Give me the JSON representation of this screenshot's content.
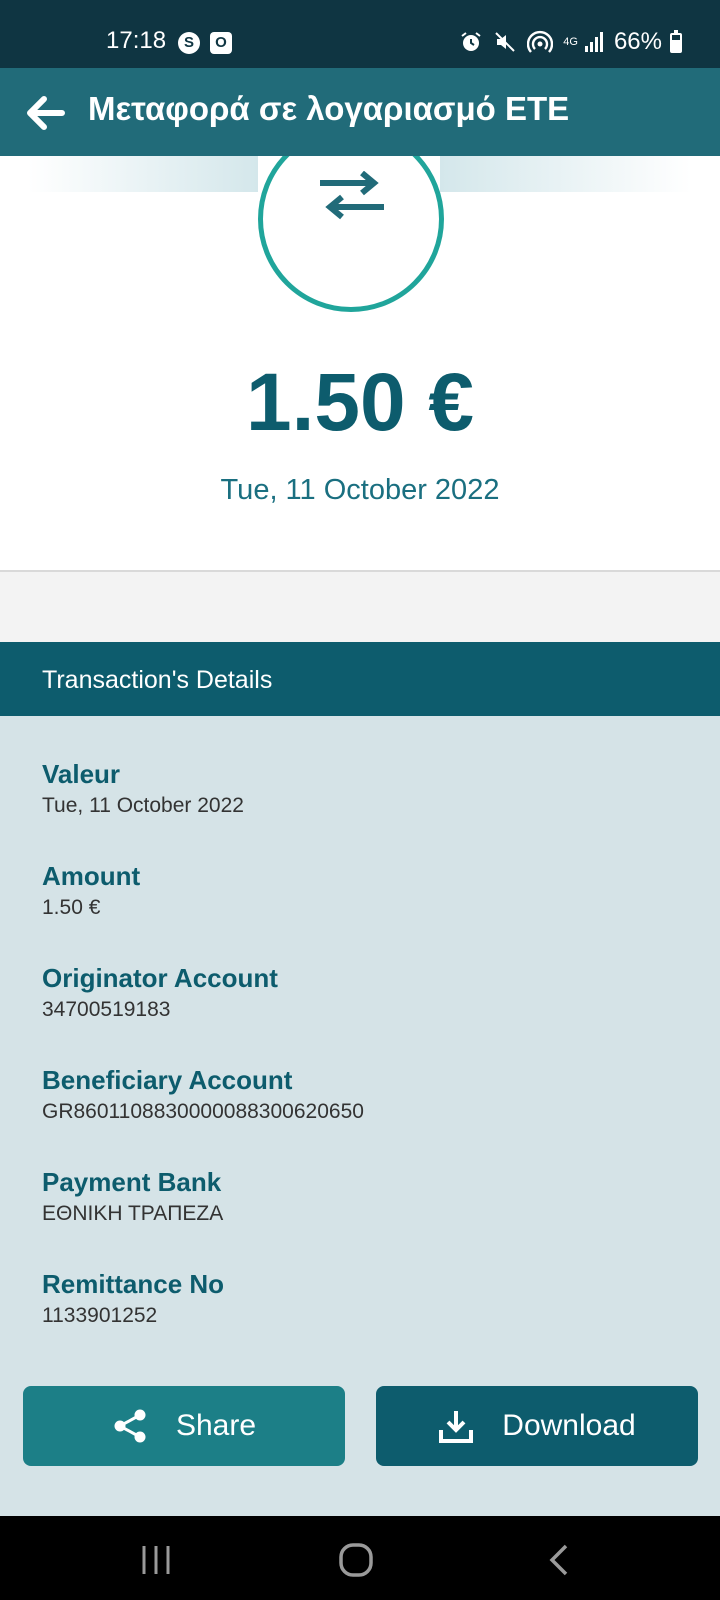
{
  "status_bar": {
    "time": "17:18",
    "app_icons": [
      "S",
      "O"
    ],
    "network": "4G",
    "battery_text": "66%",
    "battery_level": 0.66
  },
  "app_bar": {
    "title": "Μεταφορά σε λογαριασμό ETE"
  },
  "hero": {
    "amount": "1.50 €",
    "date": "Tue, 11 October 2022"
  },
  "details": {
    "header": "Transaction's Details",
    "items": [
      {
        "label": "Valeur",
        "value": "Tue, 11 October 2022"
      },
      {
        "label": "Amount",
        "value": "1.50 €"
      },
      {
        "label": "Originator Account",
        "value": "34700519183"
      },
      {
        "label": "Beneficiary Account",
        "value": "GR8601108830000088300620650"
      },
      {
        "label": "Payment Bank",
        "value": "ΕΘΝΙΚΗ ΤΡΑΠΕΖΑ"
      },
      {
        "label": "Remittance No",
        "value": "1133901252"
      }
    ]
  },
  "actions": {
    "share_label": "Share",
    "download_label": "Download"
  },
  "colors": {
    "primary_dark": "#0d5c6d",
    "app_bar": "#216b79",
    "accent_teal": "#20a59b",
    "details_bg": "#d5e3e7"
  },
  "icons": {
    "back": "arrow-left-icon",
    "transfer": "transfer-arrows-icon",
    "share": "share-icon",
    "download": "download-icon"
  }
}
